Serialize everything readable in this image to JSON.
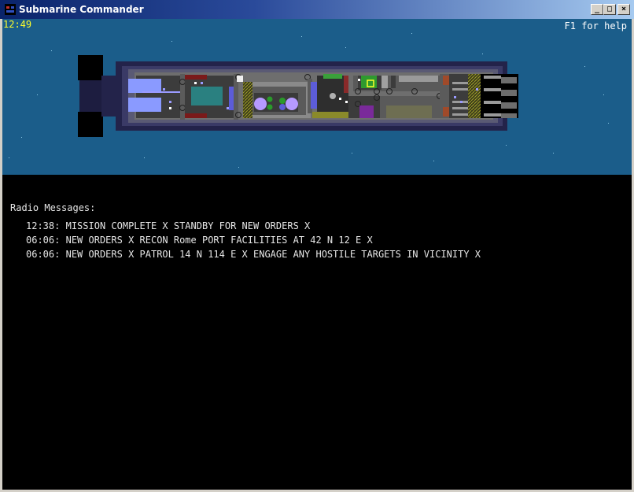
{
  "window": {
    "title": "Submarine Commander",
    "controls": {
      "minimize": "_",
      "maximize": "□",
      "close": "×"
    }
  },
  "hud": {
    "clock": "12:49",
    "help_hint": "F1 for help"
  },
  "radio": {
    "title": "Radio Messages:",
    "messages": [
      {
        "time": "12:38:",
        "text": "MISSION COMPLETE X STANDBY FOR NEW ORDERS X"
      },
      {
        "time": "06:06:",
        "text": "NEW ORDERS X RECON Rome PORT FACILITIES AT 42 N 12 E X"
      },
      {
        "time": "06:06:",
        "text": "NEW ORDERS X PATROL 14 N 114 E X ENGAGE ANY HOSTILE TARGETS IN VICINITY X"
      }
    ]
  },
  "colors": {
    "ocean": "#1b5d8a",
    "hull_outer": "#23234a",
    "hull": "#3a3a66",
    "deck": "#6e6e6e",
    "clock": "#ffff2a",
    "text": "#e6e6e6"
  }
}
